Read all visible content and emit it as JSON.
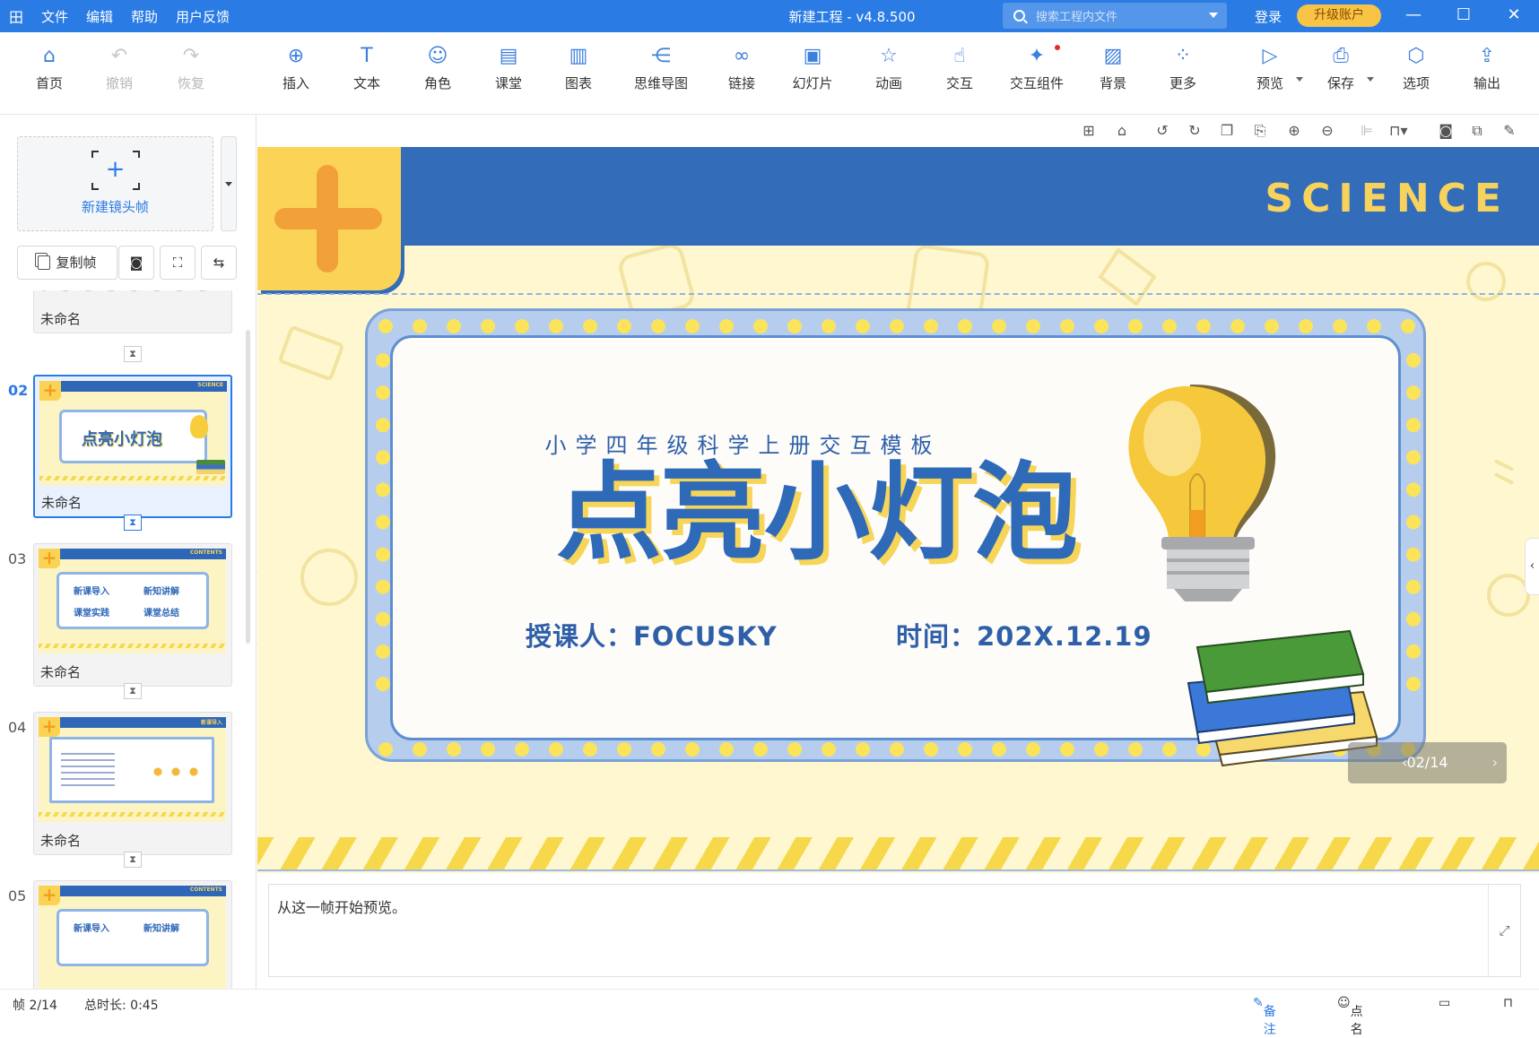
{
  "app": {
    "logo": "田",
    "menu": [
      "文件",
      "编辑",
      "帮助",
      "用户反馈"
    ],
    "title": "新建工程 - v4.8.500",
    "search_placeholder": "搜索工程内文件",
    "login": "登录",
    "upgrade": "升级账户"
  },
  "toolbar": [
    {
      "label": "首页",
      "icon": "home-icon",
      "glyph": "⌂"
    },
    {
      "label": "撤销",
      "icon": "undo-icon",
      "glyph": "↶"
    },
    {
      "label": "恢复",
      "icon": "redo-icon",
      "glyph": "↷"
    },
    {
      "label": "插入",
      "icon": "insert-icon",
      "glyph": "⊕"
    },
    {
      "label": "文本",
      "icon": "text-icon",
      "glyph": "T"
    },
    {
      "label": "角色",
      "icon": "role-icon",
      "glyph": "☺"
    },
    {
      "label": "课堂",
      "icon": "classroom-icon",
      "glyph": "▤"
    },
    {
      "label": "图表",
      "icon": "chart-icon",
      "glyph": "▥"
    },
    {
      "label": "思维导图",
      "icon": "mindmap-icon",
      "glyph": "⋲"
    },
    {
      "label": "链接",
      "icon": "link-icon",
      "glyph": "∞"
    },
    {
      "label": "幻灯片",
      "icon": "slide-icon",
      "glyph": "▣"
    },
    {
      "label": "动画",
      "icon": "animation-icon",
      "glyph": "☆"
    },
    {
      "label": "交互",
      "icon": "interaction-icon",
      "glyph": "☝"
    },
    {
      "label": "交互组件",
      "icon": "interactive-widget-icon",
      "glyph": "✦"
    },
    {
      "label": "背景",
      "icon": "background-icon",
      "glyph": "▨"
    },
    {
      "label": "更多",
      "icon": "more-icon",
      "glyph": "⁘"
    },
    {
      "label": "预览",
      "icon": "preview-icon",
      "glyph": "▷"
    },
    {
      "label": "保存",
      "icon": "save-icon",
      "glyph": "⎙"
    },
    {
      "label": "选项",
      "icon": "options-icon",
      "glyph": "⬡"
    },
    {
      "label": "输出",
      "icon": "export-icon",
      "glyph": "⇪"
    }
  ],
  "left": {
    "new_frame": "新建镜头帧",
    "copy_frame": "复制帧",
    "frames": [
      {
        "num": "",
        "name": "未命名",
        "theme": ""
      },
      {
        "num": "02",
        "name": "未命名",
        "theme": "SCIENCE",
        "thumb_title": "点亮小灯泡",
        "selected": true
      },
      {
        "num": "03",
        "name": "未命名",
        "theme": "CONTENTS",
        "items": [
          "新课导入",
          "新知讲解",
          "课堂实践",
          "课堂总结"
        ]
      },
      {
        "num": "04",
        "name": "未命名",
        "theme": "新课导入"
      },
      {
        "num": "05",
        "name": "未命名",
        "theme": "CONTENTS",
        "items": [
          "新课导入",
          "新知讲解"
        ]
      }
    ]
  },
  "slide": {
    "banner": "SCIENCE",
    "subtitle": "小学四年级科学上册交互模板",
    "title": "点亮小灯泡",
    "teacher": "授课人：FOCUSKY",
    "date": "时间：202X.12.19",
    "counter": "02/14"
  },
  "notes": {
    "text": "从这一帧开始预览。"
  },
  "status": {
    "frame": "帧 2/14",
    "duration": "总时长: 0:45",
    "notes": "备注",
    "rollcall": "点名"
  },
  "colors": {
    "accent": "#2a7be4",
    "slide_blue": "#336cb8",
    "slide_yellow": "#fbd356",
    "slide_bg": "#fff7cf"
  }
}
